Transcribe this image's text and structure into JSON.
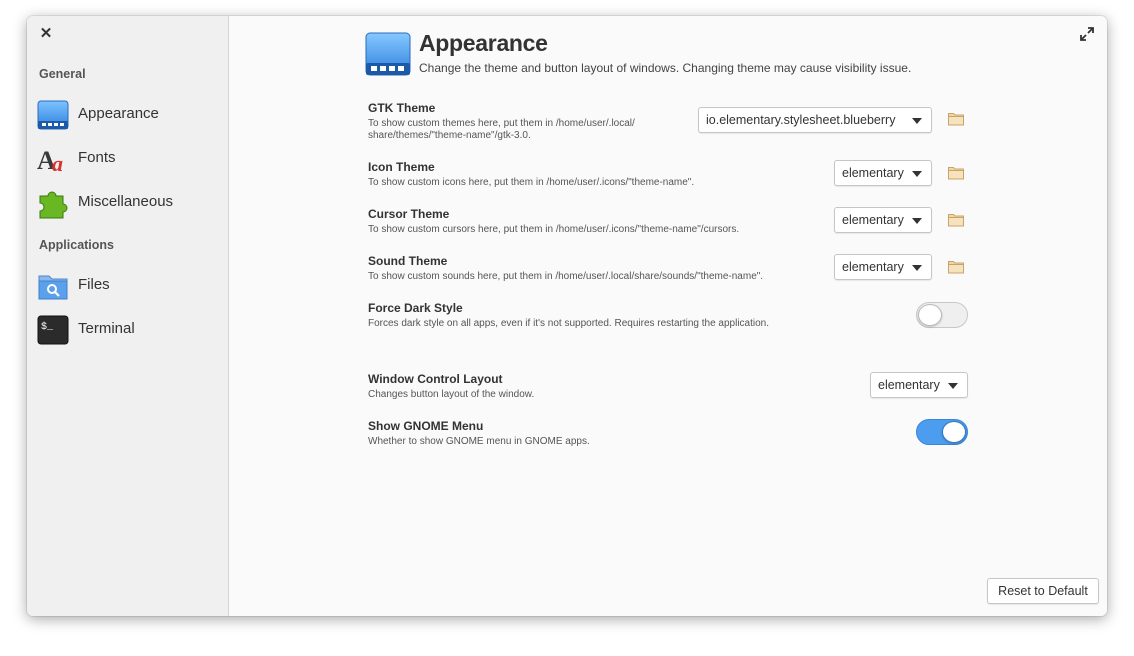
{
  "sidebar": {
    "sections": [
      {
        "heading": "General",
        "items": [
          {
            "label": "Appearance",
            "icon": "appearance-icon"
          },
          {
            "label": "Fonts",
            "icon": "fonts-icon"
          },
          {
            "label": "Miscellaneous",
            "icon": "puzzle-icon"
          }
        ]
      },
      {
        "heading": "Applications",
        "items": [
          {
            "label": "Files",
            "icon": "files-icon"
          },
          {
            "label": "Terminal",
            "icon": "terminal-icon"
          }
        ]
      }
    ],
    "icon_text": {
      "fonts": "Aa",
      "terminal": "$_"
    }
  },
  "header": {
    "title": "Appearance",
    "subtitle": "Change the theme and button layout of windows. Changing theme may cause visibility issue."
  },
  "settings": [
    {
      "title": "GTK Theme",
      "desc_line1": "To show custom themes here, put them in /home/user/.local/",
      "desc_line2": "share/themes/\"theme-name\"/gtk-3.0.",
      "value": "io.elementary.stylesheet.blueberry"
    },
    {
      "title": "Icon Theme",
      "desc": "To show custom icons here, put them in /home/user/.icons/\"theme-name\".",
      "value": "elementary"
    },
    {
      "title": "Cursor Theme",
      "desc": "To show custom cursors here, put them in /home/user/.icons/\"theme-name\"/cursors.",
      "value": "elementary"
    },
    {
      "title": "Sound Theme",
      "desc": "To show custom sounds here, put them in /home/user/.local/share/sounds/\"theme-name\".",
      "value": "elementary"
    },
    {
      "title": "Force Dark Style",
      "desc": "Forces dark style on all apps, even if it's not supported. Requires restarting the application.",
      "enabled": false
    },
    {
      "title": "Window Control Layout",
      "desc": "Changes button layout of the window.",
      "value": "elementary"
    },
    {
      "title": "Show GNOME Menu",
      "desc": "Whether to show GNOME menu in GNOME apps.",
      "enabled": true
    }
  ],
  "footer": {
    "reset_label": "Reset to Default"
  },
  "colors": {
    "accent": "#4c9cf0",
    "sidebar_bg": "#f0f0f0",
    "content_bg": "#fafafa"
  }
}
